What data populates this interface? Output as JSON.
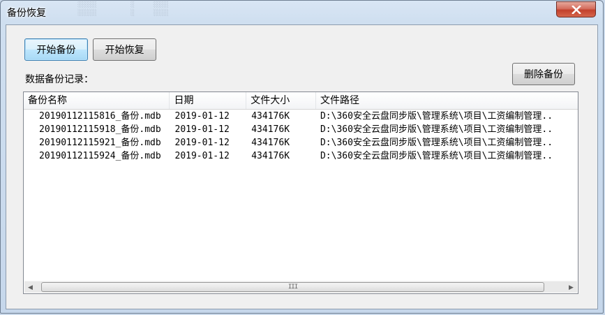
{
  "window": {
    "title": "备份恢复"
  },
  "toolbar": {
    "start_backup": "开始备份",
    "start_restore": "开始恢复",
    "delete_backup": "删除备份"
  },
  "records_label": "数据备份记录：",
  "table": {
    "columns": [
      "备份名称",
      "日期",
      "文件大小",
      "文件路径"
    ],
    "rows": [
      [
        "20190112115816_备份.mdb",
        "2019-01-12",
        "434176K",
        "D:\\360安全云盘同步版\\管理系统\\项目\\工资编制管理.."
      ],
      [
        "20190112115918_备份.mdb",
        "2019-01-12",
        "434176K",
        "D:\\360安全云盘同步版\\管理系统\\项目\\工资编制管理.."
      ],
      [
        "20190112115921_备份.mdb",
        "2019-01-12",
        "434176K",
        "D:\\360安全云盘同步版\\管理系统\\项目\\工资编制管理.."
      ],
      [
        "20190112115924_备份.mdb",
        "2019-01-12",
        "434176K",
        "D:\\360安全云盘同步版\\管理系统\\项目\\工资编制管理.."
      ]
    ]
  },
  "scrollbar": {
    "left_icon": "arrow-left-icon",
    "right_icon": "arrow-right-icon",
    "grip": "III"
  }
}
